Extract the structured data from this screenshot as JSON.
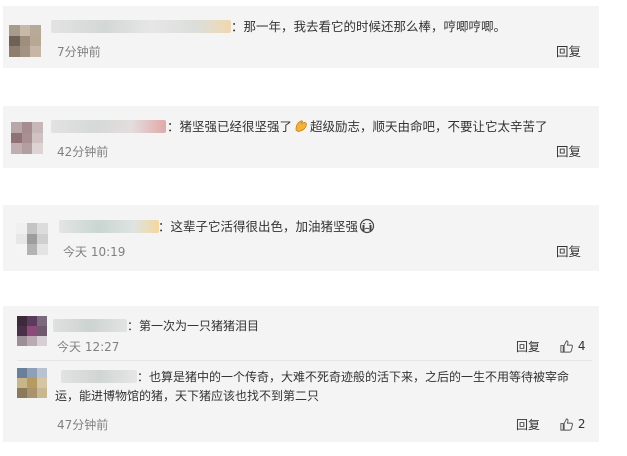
{
  "comments": [
    {
      "text": "：那一年，我去看它的时候还那么棒，哼唧哼唧。",
      "time": "7分钟前",
      "reply": "回复"
    },
    {
      "text_a": "：猪坚强已经很坚强了",
      "text_b": "超级励志，顺天由命吧，不要让它太辛苦了",
      "time": "42分钟前",
      "reply": "回复"
    },
    {
      "text": "：这辈子它活得很出色，加油猪坚强",
      "time": "今天 10:19",
      "reply": "回复"
    }
  ],
  "thread": [
    {
      "text": "：第一次为一只猪猪泪目",
      "time": "今天 12:27",
      "reply": "回复",
      "likes": "4"
    },
    {
      "text_line1": "：也算是猪中的一个传奇，大难不死奇迹般的活下来，之后的一生不用等待被宰命",
      "text_line2": "运，能进博物馆的猪，天下猪应该也找不到第二只",
      "time": "47分钟前",
      "reply": "回复",
      "likes": "2"
    }
  ],
  "icons": {
    "emoji_strong": "flexed-biceps-icon",
    "emoji_cry": "crying-face-icon",
    "like": "thumbs-up-icon"
  }
}
